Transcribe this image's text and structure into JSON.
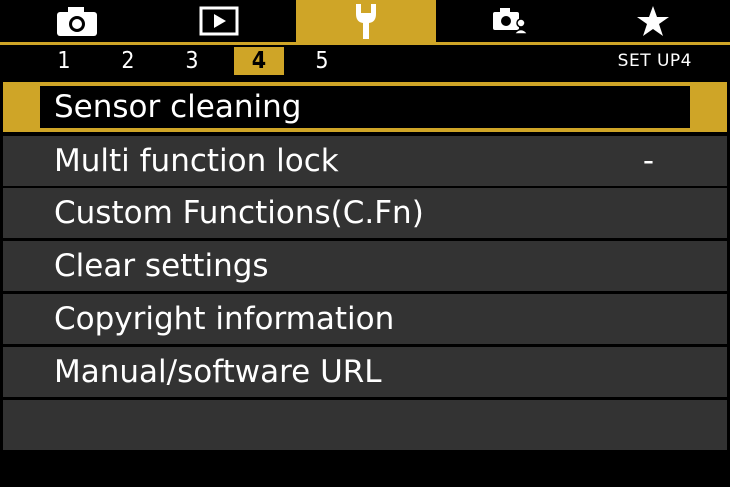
{
  "tabs": [
    {
      "icon": "camera-icon",
      "active": false
    },
    {
      "icon": "playback-icon",
      "active": false
    },
    {
      "icon": "wrench-icon",
      "active": true
    },
    {
      "icon": "custom-settings-icon",
      "active": false
    },
    {
      "icon": "star-icon",
      "active": false
    }
  ],
  "pages": [
    "1",
    "2",
    "3",
    "4",
    "5"
  ],
  "active_page": "4",
  "page_label": "SET UP4",
  "menu": [
    {
      "label": "Sensor cleaning",
      "value": "",
      "selected": true
    },
    {
      "label": "Multi function lock",
      "value": "-",
      "selected": false
    },
    {
      "label": "Custom Functions(C.Fn)",
      "value": "",
      "selected": false
    },
    {
      "label": "Clear settings",
      "value": "",
      "selected": false
    },
    {
      "label": "Copyright information",
      "value": "",
      "selected": false
    },
    {
      "label": "Manual/software URL",
      "value": "",
      "selected": false
    },
    {
      "label": "",
      "value": "",
      "selected": false
    }
  ],
  "colors": {
    "accent": "#cfa527",
    "row_bg": "#333333",
    "background": "#000000"
  }
}
